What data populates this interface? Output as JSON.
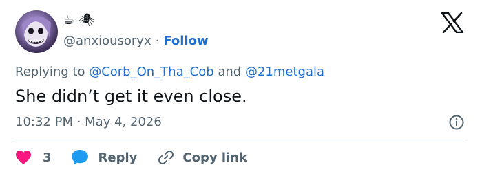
{
  "author": {
    "emojis": [
      "☕",
      "🕷"
    ],
    "handle": "@anxiousoryx",
    "separator": "·",
    "follow_label": "Follow"
  },
  "reply_context": {
    "prefix": "Replying to ",
    "mention1": "@Corb_On_Tha_Cob",
    "conjunction": " and ",
    "mention2": "@21metgala"
  },
  "tweet": {
    "text": "She didn’t get it even close.",
    "time": "10:32 PM",
    "meta_separator": " · ",
    "date": "May 4, 2026"
  },
  "actions": {
    "like_count": "3",
    "reply_label": "Reply",
    "copy_label": "Copy link"
  },
  "colors": {
    "accent": "#1d6fd1",
    "like": "#f91880",
    "muted": "#536471",
    "text": "#0f1419",
    "divider": "#cfd9de"
  },
  "icons": [
    "x-logo-icon",
    "info-icon",
    "heart-icon",
    "reply-bubble-icon",
    "link-icon"
  ]
}
